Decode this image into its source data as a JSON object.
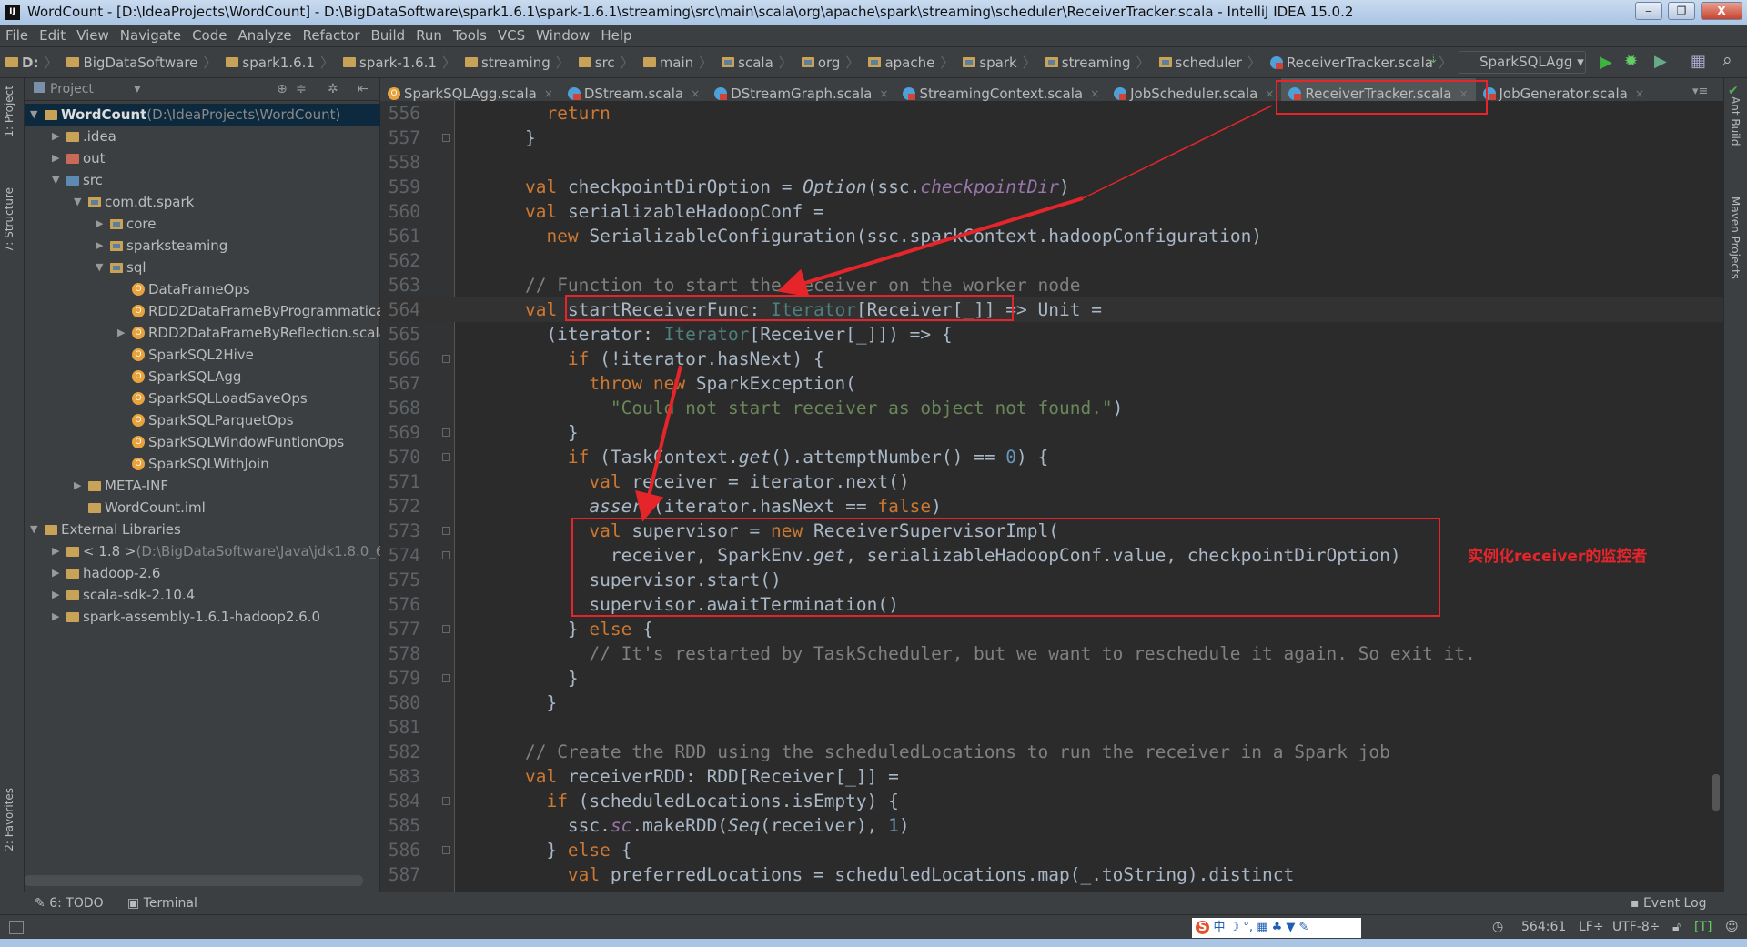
{
  "window": {
    "title": "WordCount - [D:\\IdeaProjects\\WordCount] - D:\\BigDataSoftware\\spark1.6.1\\spark-1.6.1\\streaming\\src\\main\\scala\\org\\apache\\spark\\streaming\\scheduler\\ReceiverTracker.scala - IntelliJ IDEA 15.0.2",
    "logo": "IJ",
    "minimize": "‒",
    "restore": "❐",
    "close": "X"
  },
  "menu": [
    "File",
    "Edit",
    "View",
    "Navigate",
    "Code",
    "Analyze",
    "Refactor",
    "Build",
    "Run",
    "Tools",
    "VCS",
    "Window",
    "Help"
  ],
  "breadcrumbs": [
    "D:",
    "BigDataSoftware",
    "spark1.6.1",
    "spark-1.6.1",
    "streaming",
    "src",
    "main",
    "scala",
    "org",
    "apache",
    "spark",
    "streaming",
    "scheduler",
    "ReceiverTracker.scala"
  ],
  "run_config": "SparkSQLAgg",
  "left_strip": {
    "project": "1: Project",
    "structure": "7: Structure",
    "favorites": "2: Favorites"
  },
  "right_strip": {
    "ant": "Ant Build",
    "maven": "Maven Projects"
  },
  "project_panel": {
    "title": "Project",
    "tree": [
      {
        "label": "WordCount",
        "extra": " (D:\\IdeaProjects\\WordCount)",
        "level": 0,
        "arrow": "▼",
        "icon": "module",
        "selected": true,
        "bold": true
      },
      {
        "label": ".idea",
        "level": 1,
        "arrow": "▶",
        "icon": "folder"
      },
      {
        "label": "out",
        "level": 1,
        "arrow": "▶",
        "icon": "folder-out"
      },
      {
        "label": "src",
        "level": 1,
        "arrow": "▼",
        "icon": "folder-src"
      },
      {
        "label": "com.dt.spark",
        "level": 2,
        "arrow": "▼",
        "icon": "package"
      },
      {
        "label": "core",
        "level": 3,
        "arrow": "▶",
        "icon": "package"
      },
      {
        "label": "sparksteaming",
        "level": 3,
        "arrow": "▶",
        "icon": "package"
      },
      {
        "label": "sql",
        "level": 3,
        "arrow": "▼",
        "icon": "package"
      },
      {
        "label": "DataFrameOps",
        "level": 4,
        "arrow": "",
        "icon": "object"
      },
      {
        "label": "RDD2DataFrameByProgrammatica",
        "level": 4,
        "arrow": "",
        "icon": "object"
      },
      {
        "label": "RDD2DataFrameByReflection.scala",
        "level": 4,
        "arrow": "▶",
        "icon": "object"
      },
      {
        "label": "SparkSQL2Hive",
        "level": 4,
        "arrow": "",
        "icon": "object"
      },
      {
        "label": "SparkSQLAgg",
        "level": 4,
        "arrow": "",
        "icon": "object"
      },
      {
        "label": "SparkSQLLoadSaveOps",
        "level": 4,
        "arrow": "",
        "icon": "object"
      },
      {
        "label": "SparkSQLParquetOps",
        "level": 4,
        "arrow": "",
        "icon": "object"
      },
      {
        "label": "SparkSQLWindowFuntionOps",
        "level": 4,
        "arrow": "",
        "icon": "object"
      },
      {
        "label": "SparkSQLWithJoin",
        "level": 4,
        "arrow": "",
        "icon": "object"
      },
      {
        "label": "META-INF",
        "level": 2,
        "arrow": "▶",
        "icon": "folder"
      },
      {
        "label": "WordCount.iml",
        "level": 2,
        "arrow": "",
        "icon": "file"
      },
      {
        "label": "External Libraries",
        "level": 0,
        "arrow": "▼",
        "icon": "library"
      },
      {
        "label": "< 1.8 >",
        "extra": " (D:\\BigDataSoftware\\Java\\jdk1.8.0_6",
        "level": 1,
        "arrow": "▶",
        "icon": "sdk"
      },
      {
        "label": "hadoop-2.6",
        "level": 1,
        "arrow": "▶",
        "icon": "library"
      },
      {
        "label": "scala-sdk-2.10.4",
        "level": 1,
        "arrow": "▶",
        "icon": "library"
      },
      {
        "label": "spark-assembly-1.6.1-hadoop2.6.0",
        "level": 1,
        "arrow": "▶",
        "icon": "library"
      }
    ]
  },
  "tabs": [
    {
      "label": "SparkSQLAgg.scala",
      "icon": "object"
    },
    {
      "label": "DStream.scala",
      "icon": "scala"
    },
    {
      "label": "DStreamGraph.scala",
      "icon": "scala"
    },
    {
      "label": "StreamingContext.scala",
      "icon": "scala"
    },
    {
      "label": "JobScheduler.scala",
      "icon": "scala"
    },
    {
      "label": "ReceiverTracker.scala",
      "icon": "scala",
      "active": true
    },
    {
      "label": "JobGenerator.scala",
      "icon": "scala"
    }
  ],
  "tab_close": "×",
  "editor": {
    "current_line": 564,
    "lines": [
      {
        "n": 556,
        "t": [
          [
            "      "
          ],
          [
            "return",
            "kw"
          ]
        ]
      },
      {
        "n": 557,
        "t": [
          [
            "    }"
          ]
        ],
        "fold": true
      },
      {
        "n": 558,
        "t": [
          [
            ""
          ]
        ]
      },
      {
        "n": 559,
        "t": [
          [
            "    "
          ],
          [
            "val",
            "kw"
          ],
          [
            " checkpointDirOption = "
          ],
          [
            "Option",
            "it"
          ],
          [
            "(ssc."
          ],
          [
            "checkpointDir",
            "pu"
          ],
          [
            ")"
          ]
        ]
      },
      {
        "n": 560,
        "t": [
          [
            "    "
          ],
          [
            "val",
            "kw"
          ],
          [
            " serializableHadoopConf ="
          ]
        ]
      },
      {
        "n": 561,
        "t": [
          [
            "      "
          ],
          [
            "new",
            "kw"
          ],
          [
            " SerializableConfiguration(ssc.sparkContext.hadoopConfiguration)"
          ]
        ]
      },
      {
        "n": 562,
        "t": [
          [
            ""
          ]
        ]
      },
      {
        "n": 563,
        "t": [
          [
            "    "
          ],
          [
            "// Function to start the receiver on the worker node",
            "cm"
          ]
        ]
      },
      {
        "n": 564,
        "t": [
          [
            "    "
          ],
          [
            "val",
            "kw"
          ],
          [
            " startReceiverFunc: "
          ],
          [
            "Iterator",
            "ty"
          ],
          [
            "[Receiver[_]] => Unit ="
          ]
        ]
      },
      {
        "n": 565,
        "t": [
          [
            "      (iterator: "
          ],
          [
            "Iterator",
            "ty"
          ],
          [
            "[Receiver[_]]) => {"
          ]
        ]
      },
      {
        "n": 566,
        "t": [
          [
            "        "
          ],
          [
            "if",
            "kw"
          ],
          [
            " (!iterator.hasNext) {"
          ]
        ],
        "fold": true
      },
      {
        "n": 567,
        "t": [
          [
            "          "
          ],
          [
            "throw new",
            "kw"
          ],
          [
            " SparkException("
          ]
        ]
      },
      {
        "n": 568,
        "t": [
          [
            "            "
          ],
          [
            "\"Could not start receiver as object not found.\"",
            "str"
          ],
          [
            ")"
          ]
        ]
      },
      {
        "n": 569,
        "t": [
          [
            "        }"
          ]
        ],
        "fold": true
      },
      {
        "n": 570,
        "t": [
          [
            "        "
          ],
          [
            "if",
            "kw"
          ],
          [
            " (TaskContext."
          ],
          [
            "get",
            "it"
          ],
          [
            "().attemptNumber() == "
          ],
          [
            "0",
            "num"
          ],
          [
            ") {"
          ]
        ],
        "fold": true
      },
      {
        "n": 571,
        "t": [
          [
            "          "
          ],
          [
            "val",
            "kw"
          ],
          [
            " receiver = iterator.next()"
          ]
        ]
      },
      {
        "n": 572,
        "t": [
          [
            "          "
          ],
          [
            "assert",
            "it"
          ],
          [
            "(iterator.hasNext == "
          ],
          [
            "false",
            "kw"
          ],
          [
            ")"
          ]
        ]
      },
      {
        "n": 573,
        "t": [
          [
            "          "
          ],
          [
            "val",
            "kw"
          ],
          [
            " supervisor = "
          ],
          [
            "new",
            "kw"
          ],
          [
            " ReceiverSupervisorImpl("
          ]
        ],
        "fold": true
      },
      {
        "n": 574,
        "t": [
          [
            "            receiver, SparkEnv."
          ],
          [
            "get",
            "it"
          ],
          [
            ", serializableHadoopConf.value, checkpointDirOption)"
          ]
        ],
        "fold": true
      },
      {
        "n": 575,
        "t": [
          [
            "          supervisor.start()"
          ]
        ]
      },
      {
        "n": 576,
        "t": [
          [
            "          supervisor.awaitTermination()"
          ]
        ]
      },
      {
        "n": 577,
        "t": [
          [
            "        } "
          ],
          [
            "else",
            "kw"
          ],
          [
            " {"
          ]
        ],
        "fold": true
      },
      {
        "n": 578,
        "t": [
          [
            "          "
          ],
          [
            "// It's restarted by TaskScheduler, but we want to reschedule it again. So exit it.",
            "cm"
          ]
        ]
      },
      {
        "n": 579,
        "t": [
          [
            "        }"
          ]
        ],
        "fold": true
      },
      {
        "n": 580,
        "t": [
          [
            "      }"
          ]
        ]
      },
      {
        "n": 581,
        "t": [
          [
            ""
          ]
        ]
      },
      {
        "n": 582,
        "t": [
          [
            "    "
          ],
          [
            "// Create the RDD using the scheduledLocations to run the receiver in a Spark job",
            "cm"
          ]
        ]
      },
      {
        "n": 583,
        "t": [
          [
            "    "
          ],
          [
            "val",
            "kw"
          ],
          [
            " receiverRDD: RDD[Receiver[_]] ="
          ]
        ]
      },
      {
        "n": 584,
        "t": [
          [
            "      "
          ],
          [
            "if",
            "kw"
          ],
          [
            " (scheduledLocations.isEmpty) {"
          ]
        ],
        "fold": true
      },
      {
        "n": 585,
        "t": [
          [
            "        ssc."
          ],
          [
            "sc",
            "pu"
          ],
          [
            ".makeRDD("
          ],
          [
            "Seq",
            "it"
          ],
          [
            "(receiver), "
          ],
          [
            "1",
            "num"
          ],
          [
            ")"
          ]
        ]
      },
      {
        "n": 586,
        "t": [
          [
            "      } "
          ],
          [
            "else",
            "kw"
          ],
          [
            " {"
          ]
        ],
        "fold": true
      },
      {
        "n": 587,
        "t": [
          [
            "        "
          ],
          [
            "val",
            "kw"
          ],
          [
            " preferredLocations = scheduledLocations.map(_.toString).distinct"
          ]
        ]
      }
    ]
  },
  "annotation": "实例化receiver的监控者",
  "annotation_color": "#e5252a",
  "bottom_bar": {
    "todo": "6: TODO",
    "terminal": "Terminal",
    "event_log": "Event Log"
  },
  "status": {
    "position": "564:61",
    "line_sep": "LF÷",
    "encoding": "UTF-8÷"
  }
}
